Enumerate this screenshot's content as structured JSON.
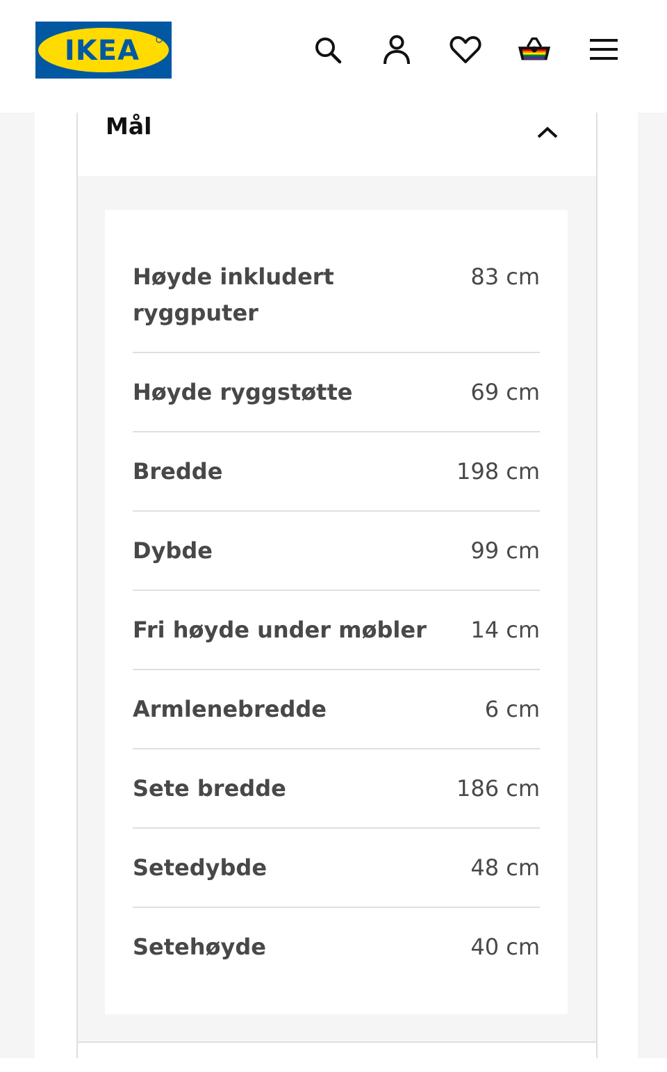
{
  "header": {
    "logo_text": "IKEA",
    "icons": [
      "search-icon",
      "account-icon",
      "heart-icon",
      "basket-icon",
      "menu-icon"
    ],
    "brand_colors": {
      "blue": "#0058a3",
      "yellow": "#ffdb00"
    }
  },
  "section": {
    "title": "Mål",
    "expanded": true
  },
  "dimensions": [
    {
      "label": "Høyde inkludert ryggputer",
      "value": "83 cm"
    },
    {
      "label": "Høyde ryggstøtte",
      "value": "69 cm"
    },
    {
      "label": "Bredde",
      "value": "198 cm"
    },
    {
      "label": "Dybde",
      "value": "99 cm"
    },
    {
      "label": "Fri høyde under møbler",
      "value": "14 cm"
    },
    {
      "label": "Armlenebredde",
      "value": "6 cm"
    },
    {
      "label": "Sete bredde",
      "value": "186 cm"
    },
    {
      "label": "Setedybde",
      "value": "48 cm"
    },
    {
      "label": "Setehøyde",
      "value": "40 cm"
    }
  ]
}
